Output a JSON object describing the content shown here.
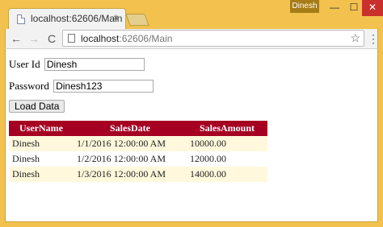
{
  "window": {
    "user_badge": "Dinesh",
    "min_glyph": "—",
    "max_glyph": "☐",
    "close_glyph": "✕"
  },
  "tab": {
    "title": "localhost:62606/Main",
    "close_glyph": "×"
  },
  "toolbar": {
    "back_glyph": "←",
    "forward_glyph": "→",
    "reload_glyph": "C",
    "url_host": "localhost",
    "url_rest": ":62606/Main",
    "star_glyph": "☆",
    "menu_glyph": "⋮"
  },
  "form": {
    "userid_label": "User Id",
    "userid_value": "Dinesh",
    "password_label": "Password",
    "password_value": "Dinesh123",
    "load_button": "Load Data"
  },
  "table": {
    "headers": [
      "UserName",
      "SalesDate",
      "SalesAmount"
    ],
    "rows": [
      [
        "Dinesh",
        "1/1/2016 12:00:00 AM",
        "10000.00"
      ],
      [
        "Dinesh",
        "1/2/2016 12:00:00 AM",
        "12000.00"
      ],
      [
        "Dinesh",
        "1/3/2016 12:00:00 AM",
        "14000.00"
      ]
    ]
  },
  "colors": {
    "frame": "#f2c14e",
    "header_bg": "#a50021",
    "alt_row_bg": "#fff8dc"
  }
}
